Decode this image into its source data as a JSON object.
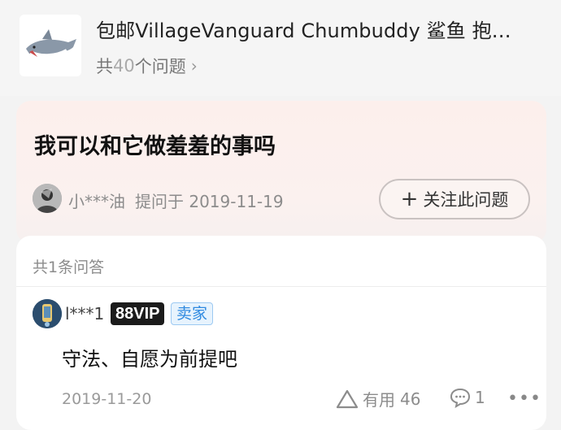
{
  "product": {
    "title": "包邮VillageVanguard Chumbuddy 鲨鱼 抱…",
    "count_prefix": "共",
    "count": "40",
    "count_suffix": "个问题",
    "thumb_icon": "shark-plush-image"
  },
  "question": {
    "title": "我可以和它做羞羞的事吗",
    "asker": "小***油",
    "asked_on": "提问于 2019-11-19",
    "follow_label": "关注此问题"
  },
  "answers": {
    "count_label": "共1条问答",
    "items": [
      {
        "user": "l***1",
        "vip_badge": "88VIP",
        "role_badge": "卖家",
        "text": "守法、自愿为前提吧",
        "date": "2019-11-20",
        "useful_label": "有用",
        "useful_count": "46",
        "comment_count": "1"
      }
    ]
  },
  "colors": {
    "vip_bg": "#1b1b1b",
    "seller_text": "#2f8ae0",
    "muted": "#8c8c8c"
  }
}
